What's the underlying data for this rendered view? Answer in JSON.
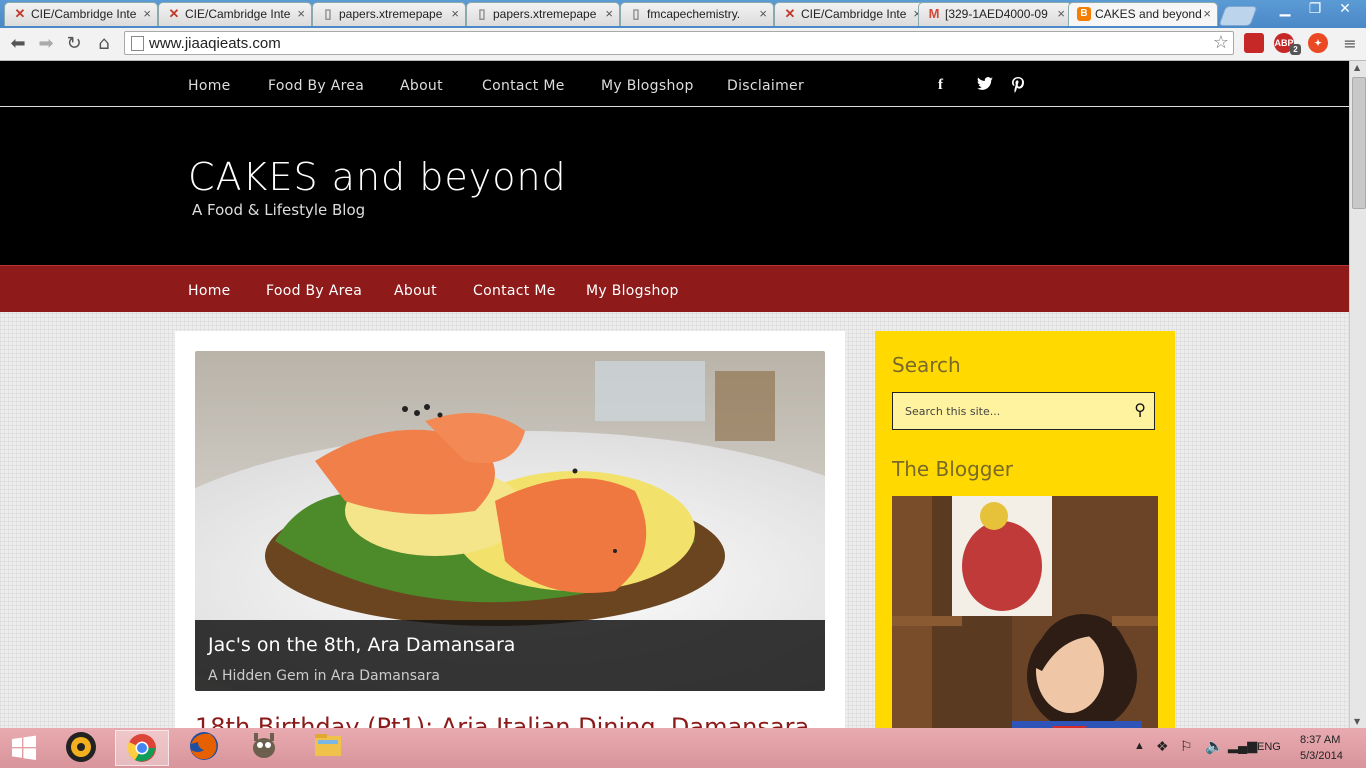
{
  "browser": {
    "tabs": [
      {
        "label": "CIE/Cambridge Inte",
        "icon": "x-icon",
        "icon_color": "#c0392b"
      },
      {
        "label": "CIE/Cambridge Inte",
        "icon": "x-icon",
        "icon_color": "#c0392b"
      },
      {
        "label": "papers.xtremepape",
        "icon": "page-icon",
        "icon_color": "#888888"
      },
      {
        "label": "papers.xtremepape",
        "icon": "page-icon",
        "icon_color": "#888888"
      },
      {
        "label": "fmcapechemistry.",
        "icon": "page-icon",
        "icon_color": "#888888"
      },
      {
        "label": "CIE/Cambridge Inte",
        "icon": "x-icon",
        "icon_color": "#c0392b"
      },
      {
        "label": "[329-1AED4000-09",
        "icon": "gmail-icon",
        "icon_color": "#d14836"
      },
      {
        "label": "CAKES and beyond",
        "icon": "blogger-icon",
        "icon_color": "#f57d00"
      }
    ],
    "url": "www.jiaaqieats.com",
    "extensions": [
      "ABP",
      "2"
    ]
  },
  "site": {
    "top_nav": [
      "Home",
      "Food By Area",
      "About",
      "Contact Me",
      "My Blogshop",
      "Disclaimer"
    ],
    "social": [
      "f",
      "t",
      "p"
    ],
    "title": "CAKES and beyond",
    "tagline": "A Food & Lifestyle Blog",
    "main_nav": [
      "Home",
      "Food By Area",
      "About",
      "Contact Me",
      "My Blogshop"
    ]
  },
  "featured": {
    "title": "Jac's on the 8th, Ara Damansara",
    "subtitle": "A Hidden Gem in Ara Damansara"
  },
  "post": {
    "title": "18th Birthday (Pt1): Aria Italian Dining, Damansara"
  },
  "sidebar": {
    "search_heading": "Search",
    "search_placeholder": "Search this site...",
    "blogger_heading": "The Blogger"
  },
  "taskbar": {
    "language": "ENG",
    "time": "8:37 AM",
    "date": "5/3/2014"
  },
  "colors": {
    "header_bg": "#000000",
    "nav_red": "#8e1a1a",
    "sidebar_yellow": "#ffd900",
    "post_title": "#8b1a1a"
  }
}
